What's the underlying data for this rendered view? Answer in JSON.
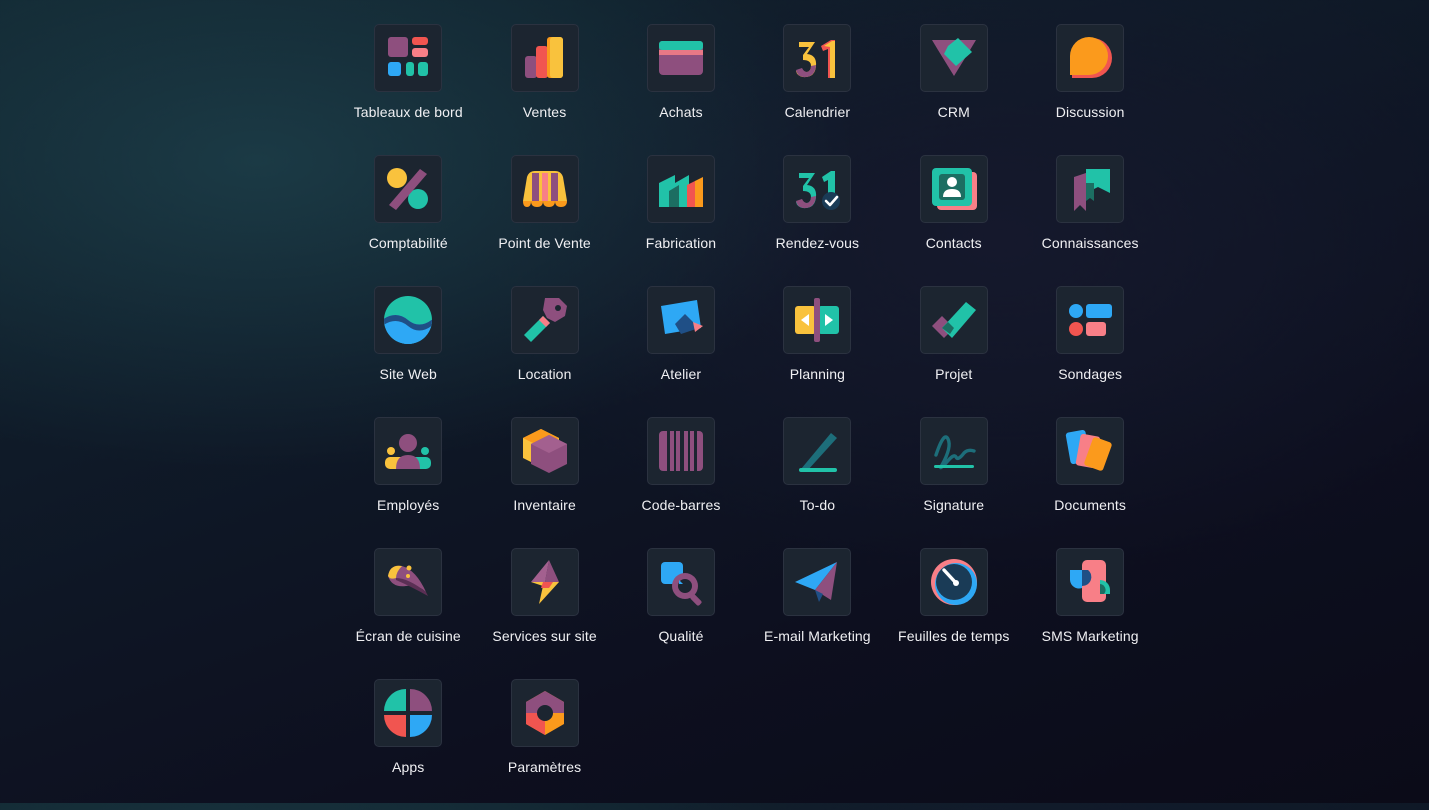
{
  "colors": {
    "teal": "#21c2a8",
    "purple": "#8e4f7e",
    "orange": "#fb9a1c",
    "yellow": "#f9c23d",
    "blue": "#2ea8f5",
    "pink": "#f87f87",
    "red": "#f15550",
    "dark": "#1a3b56"
  },
  "apps": [
    {
      "label": "Tableaux de bord",
      "icon": "dashboard-icon"
    },
    {
      "label": "Ventes",
      "icon": "sales-icon"
    },
    {
      "label": "Achats",
      "icon": "purchase-icon"
    },
    {
      "label": "Calendrier",
      "icon": "calendar-icon"
    },
    {
      "label": "CRM",
      "icon": "crm-icon"
    },
    {
      "label": "Discussion",
      "icon": "discussion-icon"
    },
    {
      "label": "Comptabilité",
      "icon": "accounting-icon"
    },
    {
      "label": "Point de Vente",
      "icon": "point-of-sale-icon"
    },
    {
      "label": "Fabrication",
      "icon": "manufacturing-icon"
    },
    {
      "label": "Rendez-vous",
      "icon": "appointment-icon"
    },
    {
      "label": "Contacts",
      "icon": "contacts-icon"
    },
    {
      "label": "Connaissances",
      "icon": "knowledge-icon"
    },
    {
      "label": "Site Web",
      "icon": "website-icon"
    },
    {
      "label": "Location",
      "icon": "rental-icon"
    },
    {
      "label": "Atelier",
      "icon": "workshop-icon"
    },
    {
      "label": "Planning",
      "icon": "planning-icon"
    },
    {
      "label": "Projet",
      "icon": "project-icon"
    },
    {
      "label": "Sondages",
      "icon": "surveys-icon"
    },
    {
      "label": "Employés",
      "icon": "employees-icon"
    },
    {
      "label": "Inventaire",
      "icon": "inventory-icon"
    },
    {
      "label": "Code-barres",
      "icon": "barcode-icon"
    },
    {
      "label": "To-do",
      "icon": "todo-icon"
    },
    {
      "label": "Signature",
      "icon": "signature-icon"
    },
    {
      "label": "Documents",
      "icon": "documents-icon"
    },
    {
      "label": "Écran de cuisine",
      "icon": "kitchen-display-icon"
    },
    {
      "label": "Services sur site",
      "icon": "field-service-icon"
    },
    {
      "label": "Qualité",
      "icon": "quality-icon"
    },
    {
      "label": "E-mail Marketing",
      "icon": "email-marketing-icon"
    },
    {
      "label": "Feuilles de temps",
      "icon": "timesheets-icon"
    },
    {
      "label": "SMS Marketing",
      "icon": "sms-marketing-icon"
    },
    {
      "label": "Apps",
      "icon": "apps-icon"
    },
    {
      "label": "Paramètres",
      "icon": "settings-icon"
    }
  ]
}
